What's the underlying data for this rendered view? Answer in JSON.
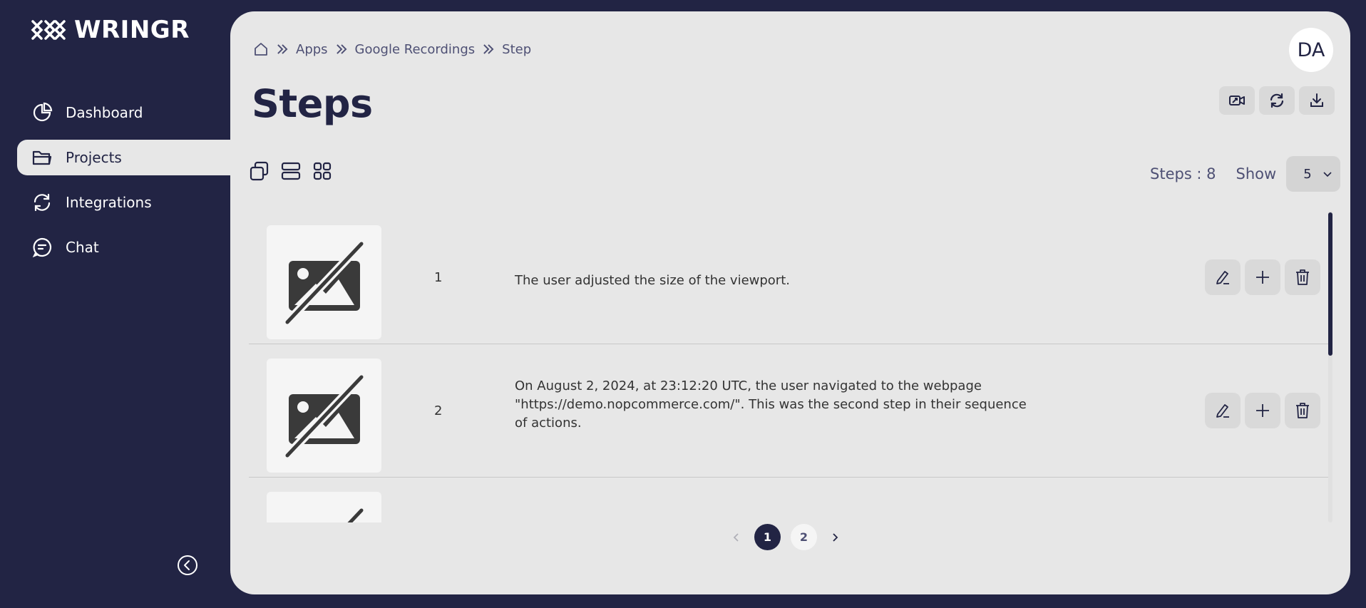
{
  "app": {
    "name": "WRINGR"
  },
  "sidebar": {
    "items": [
      {
        "label": "Dashboard",
        "icon": "pie-chart-icon",
        "active": false
      },
      {
        "label": "Projects",
        "icon": "folder-icon",
        "active": true
      },
      {
        "label": "Integrations",
        "icon": "refresh-icon",
        "active": false
      },
      {
        "label": "Chat",
        "icon": "chat-icon",
        "active": false
      }
    ],
    "collapse_icon": "chevron-left-circle-icon"
  },
  "breadcrumb": {
    "home_icon": "home-icon",
    "items": [
      "Apps",
      "Google Recordings",
      "Step"
    ]
  },
  "user": {
    "initials": "DA"
  },
  "page": {
    "title": "Steps"
  },
  "toolbar": {
    "actions": [
      "video-icon",
      "refresh-icon",
      "download-icon"
    ]
  },
  "view_toggles": [
    "overlap-view-icon",
    "list-view-icon",
    "grid-view-icon"
  ],
  "summary": {
    "steps_label": "Steps : 8",
    "show_label": "Show",
    "page_size": "5"
  },
  "steps": [
    {
      "number": "1",
      "text": "The user adjusted the size of the viewport."
    },
    {
      "number": "2",
      "text": "On August 2, 2024, at 23:12:20 UTC, the user navigated to the webpage \"https://demo.nopcommerce.com/\". This was the second step in their sequence of actions."
    },
    {
      "number": "",
      "text": ""
    }
  ],
  "row_actions": [
    "edit-icon",
    "add-icon",
    "delete-icon"
  ],
  "pagination": {
    "pages": [
      "1",
      "2"
    ],
    "current": "1"
  },
  "colors": {
    "sidebar_bg": "#222444",
    "panel_bg": "#e7e7e7",
    "accent": "#222444"
  }
}
